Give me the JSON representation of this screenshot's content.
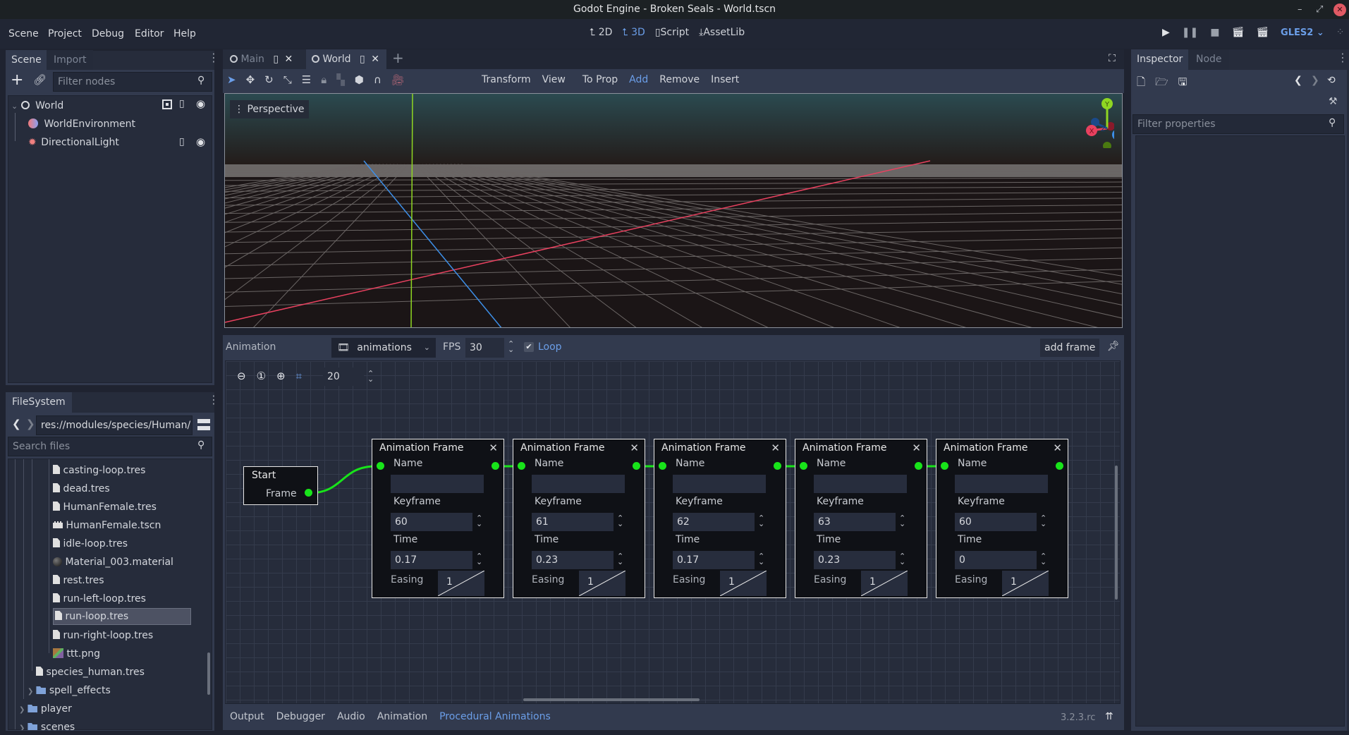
{
  "window": {
    "title": "Godot Engine - Broken Seals - World.tscn",
    "controls": {
      "minimize": "–",
      "restore": "⤢",
      "close": "✕"
    }
  },
  "menu": {
    "items": [
      "Scene",
      "Project",
      "Debug",
      "Editor",
      "Help"
    ]
  },
  "workspaces": [
    {
      "label": "2D",
      "icon": "2d-icon",
      "active": false
    },
    {
      "label": "3D",
      "icon": "3d-icon",
      "active": true
    },
    {
      "label": "Script",
      "icon": "script-icon",
      "active": false
    },
    {
      "label": "AssetLib",
      "icon": "assetlib-icon",
      "active": false
    }
  ],
  "run_controls": {
    "renderer": "GLES2"
  },
  "scene_dock": {
    "tabs": [
      "Scene",
      "Import"
    ],
    "active_tab": "Scene",
    "filter_placeholder": "Filter nodes",
    "tree": [
      {
        "label": "World",
        "icon": "node3d-icon",
        "level": 0,
        "expanded": true
      },
      {
        "label": "WorldEnvironment",
        "icon": "world-environment-icon",
        "level": 1
      },
      {
        "label": "DirectionalLight",
        "icon": "directional-light-icon",
        "level": 1
      }
    ]
  },
  "filesystem_dock": {
    "tab": "FileSystem",
    "path": "res://modules/species/Human/",
    "search_placeholder": "Search files",
    "files": [
      {
        "label": "casting-loop.tres",
        "icon": "file-icon"
      },
      {
        "label": "dead.tres",
        "icon": "file-icon"
      },
      {
        "label": "HumanFemale.tres",
        "icon": "file-icon"
      },
      {
        "label": "HumanFemale.tscn",
        "icon": "scene-icon"
      },
      {
        "label": "idle-loop.tres",
        "icon": "file-icon"
      },
      {
        "label": "Material_003.material",
        "icon": "material-icon"
      },
      {
        "label": "rest.tres",
        "icon": "file-icon"
      },
      {
        "label": "run-left-loop.tres",
        "icon": "file-icon"
      },
      {
        "label": "run-loop.tres",
        "icon": "file-icon",
        "selected": true
      },
      {
        "label": "run-right-loop.tres",
        "icon": "file-icon"
      },
      {
        "label": "ttt.png",
        "icon": "image-icon"
      },
      {
        "label": "species_human.tres",
        "icon": "file-icon"
      },
      {
        "label": "spell_effects",
        "icon": "folder-icon"
      },
      {
        "label": "player",
        "icon": "folder-icon"
      },
      {
        "label": "scenes",
        "icon": "folder-icon"
      }
    ]
  },
  "scene_tabs": [
    {
      "label": "Main",
      "active": false
    },
    {
      "label": "World",
      "active": true
    }
  ],
  "toolbar": {
    "menus": [
      "Transform",
      "View",
      "To Prop",
      "Add",
      "Remove",
      "Insert"
    ],
    "highlighted": "Add"
  },
  "viewport": {
    "mode_label": "Perspective",
    "gizmo": {
      "x": "X",
      "y": "Y",
      "z": "Z"
    }
  },
  "animation_panel": {
    "label": "Animation",
    "resource": "animations",
    "fps_label": "FPS",
    "fps": "30",
    "loop_label": "Loop",
    "loop_checked": true,
    "add_frame": "add frame",
    "snap_value": "20"
  },
  "graph": {
    "start_node": {
      "title": "Start",
      "port_label": "Frame"
    },
    "frame_labels": {
      "title": "Animation Frame",
      "name": "Name",
      "keyframe": "Keyframe",
      "time": "Time",
      "easing": "Easing"
    },
    "frames": [
      {
        "name": "",
        "keyframe": "60",
        "time": "0.17",
        "easing": "1"
      },
      {
        "name": "",
        "keyframe": "61",
        "time": "0.23",
        "easing": "1"
      },
      {
        "name": "",
        "keyframe": "62",
        "time": "0.17",
        "easing": "1"
      },
      {
        "name": "",
        "keyframe": "63",
        "time": "0.23",
        "easing": "1"
      },
      {
        "name": "",
        "keyframe": "60",
        "time": "0",
        "easing": "1"
      }
    ]
  },
  "bottom_tabs": {
    "items": [
      "Output",
      "Debugger",
      "Audio",
      "Animation",
      "Procedural Animations"
    ],
    "active": "Procedural Animations",
    "version": "3.2.3.rc"
  },
  "inspector": {
    "tabs": [
      "Inspector",
      "Node"
    ],
    "active_tab": "Inspector",
    "filter_placeholder": "Filter properties"
  },
  "colors": {
    "accent": "#6b9ee8",
    "port": "#18e41a",
    "axis_x": "#e8415f",
    "axis_y": "#8fd622",
    "axis_z": "#3d8fe8"
  }
}
